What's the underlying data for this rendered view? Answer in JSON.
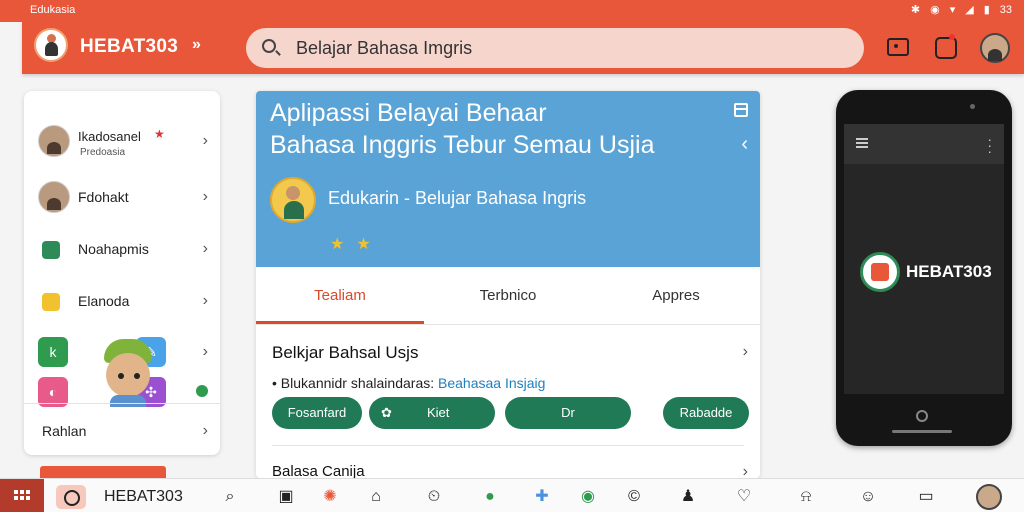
{
  "status": {
    "carrier": "Edukasia",
    "time": "33"
  },
  "header": {
    "brand": "HEBAT303",
    "chevrons": "»",
    "search_value": "Belajar Bahasa Imgris"
  },
  "sidebar": {
    "items": [
      {
        "label": "Ikadosanel",
        "sublabel": "Predoasia"
      },
      {
        "label": "Fdohakt"
      },
      {
        "label": "Noahapmis"
      },
      {
        "label": "Elanoda"
      },
      {
        "label": "Rahlan"
      }
    ]
  },
  "card": {
    "title_line1": "Aplipassi Belayai Behaar",
    "title_line2": "Bahasa Inggris Tebur Semau Usjia",
    "subtitle": "Edukarin - Belujar Bahasa Ingris",
    "rating_stars": 2,
    "tabs": [
      "Tealiam",
      "Terbnico",
      "Appres"
    ],
    "active_tab": 0,
    "section_title": "Belkjar Bahsal Usjs",
    "bullet_text": "Blukannidr shalaindaras:",
    "bullet_link": "Beahasaa Insjaig",
    "pills": [
      "Fosanfard",
      "Kiet",
      "Dr",
      "Rabadde"
    ],
    "section2_title": "Balasa Canija"
  },
  "phone": {
    "app_name": "HEBAT303"
  },
  "bottombar": {
    "name": "HEBAT303"
  },
  "colors": {
    "primary": "#e9573b",
    "banner": "#5aa3d6",
    "pill": "#1f7a55",
    "tab_active": "#d84a2b"
  }
}
